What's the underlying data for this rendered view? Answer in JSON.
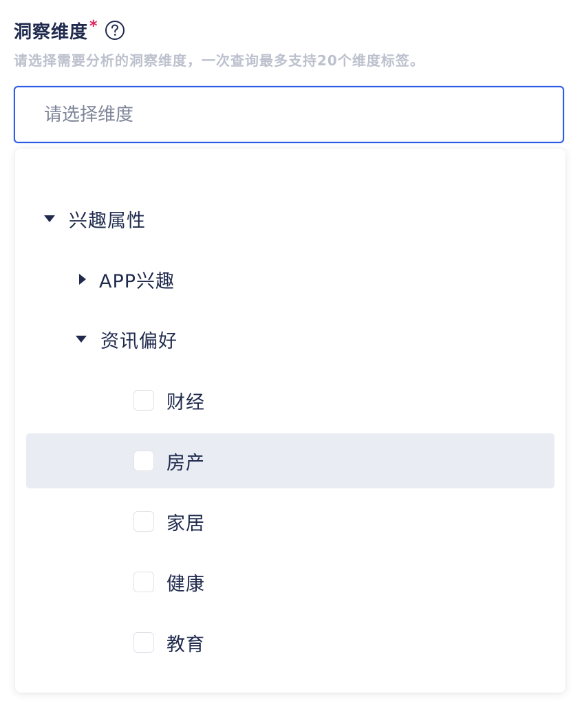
{
  "field": {
    "label": "洞察维度",
    "required_mark": "*",
    "help_icon": "question-circle-icon",
    "description": "请选择需要分析的洞察维度，一次查询最多支持20个维度标签。"
  },
  "select": {
    "placeholder": "请选择维度",
    "value": ""
  },
  "tree": {
    "root": {
      "label": "兴趣属性",
      "expanded": true
    },
    "children": [
      {
        "label": "APP兴趣",
        "expanded": false
      },
      {
        "label": "资讯偏好",
        "expanded": true
      }
    ],
    "leaves": [
      {
        "label": "财经",
        "checked": false
      },
      {
        "label": "房产",
        "checked": false,
        "hovered": true
      },
      {
        "label": "家居",
        "checked": false
      },
      {
        "label": "健康",
        "checked": false
      },
      {
        "label": "教育",
        "checked": false
      }
    ]
  },
  "colors": {
    "accent": "#2b5ce6",
    "required": "#e0245e",
    "text": "#1f2a4d",
    "muted": "#bcc1cd",
    "hover_bg": "#e9ecf3"
  }
}
